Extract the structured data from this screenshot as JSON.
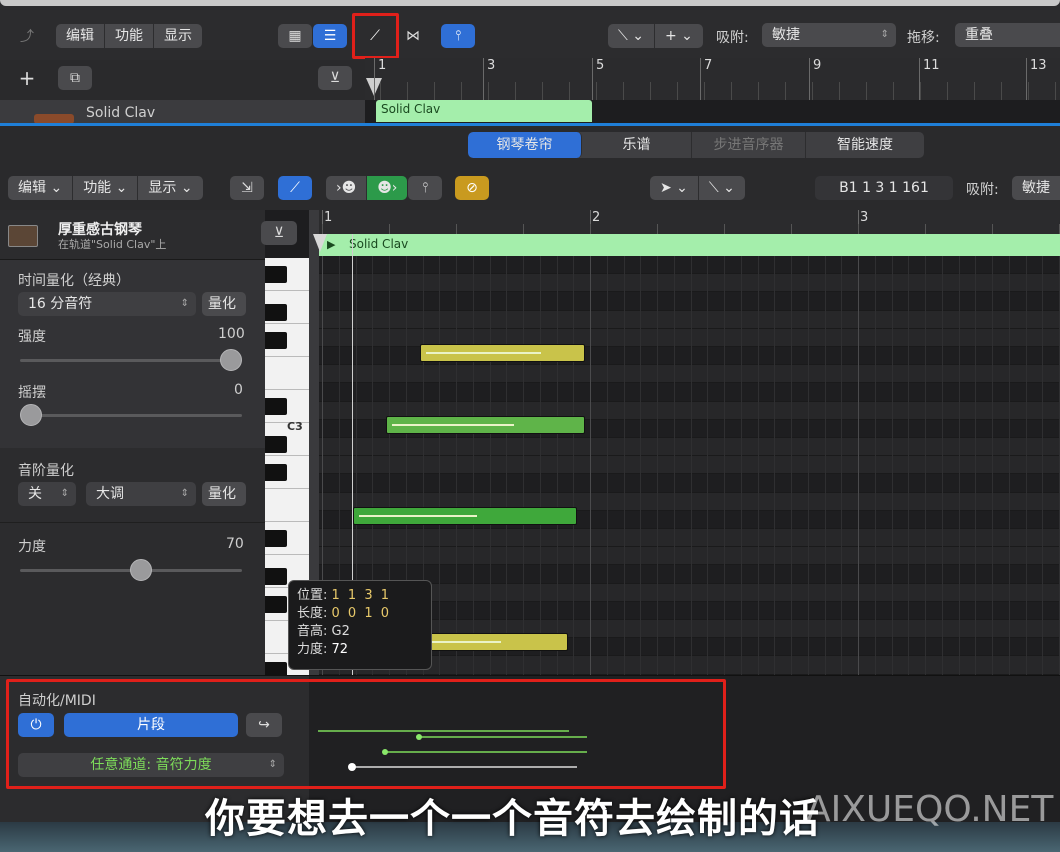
{
  "colors": {
    "accent": "#2f6fd6",
    "green_region": "#a4eeab",
    "note_yellow": "#c9c34a",
    "note_green": "#58b447",
    "highlight_box": "#e0201a"
  },
  "top": {
    "menu": [
      "编辑",
      "功能",
      "显示"
    ],
    "snap_label": "吸附:",
    "snap_value": "敏捷",
    "drag_label": "拖移:",
    "drag_value": "重叠",
    "ruler": [
      "1",
      "3",
      "5",
      "7",
      "9",
      "11",
      "13"
    ],
    "track_name": "Solid Clav",
    "region_name": "Solid Clav"
  },
  "editor": {
    "tabs": [
      "钢琴卷帘",
      "乐谱",
      "步进音序器",
      "智能速度"
    ],
    "menu": [
      "编辑",
      "功能",
      "显示"
    ],
    "position_readout": "B1  1 3 1 161",
    "snap_label": "吸附:",
    "snap_value": "敏捷",
    "ruler": [
      "1",
      "2",
      "3"
    ],
    "region_name": "Solid Clav"
  },
  "inspector": {
    "instrument_name": "厚重感古钢琴",
    "instrument_sub": "在轨道\"Solid Clav\"上",
    "time_quantize_title": "时间量化（经典）",
    "quantize_value": "16 分音符",
    "quantize_button": "量化",
    "strength_label": "强度",
    "strength_value": "100",
    "strength_level": 1.0,
    "swing_label": "摇摆",
    "swing_value": "0",
    "swing_level": 0.0,
    "scale_quantize_title": "音阶量化",
    "scale_off": "关",
    "scale_mode": "大调",
    "scale_button": "量化",
    "velocity_label": "力度",
    "velocity_value": "70",
    "velocity_level": 0.55
  },
  "piano": {
    "c3_label": "C3"
  },
  "tooltip": {
    "position_label": "位置:",
    "position_value": "1 1 3 1",
    "length_label": "长度:",
    "length_value": "0 0 1 0",
    "pitch_label": "音高:",
    "pitch_value": "G2",
    "velocity_label": "力度:",
    "velocity_value": "72"
  },
  "automation": {
    "title": "自动化/MIDI",
    "mode_button": "片段",
    "channel_select": "任意通道: 音符力度"
  },
  "subtitle": "你要想去一个一个音符去绘制的话",
  "watermark": "AIXUEQO.NET"
}
